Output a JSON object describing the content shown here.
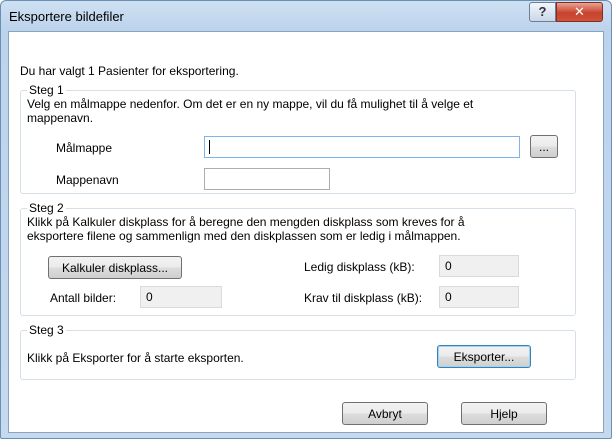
{
  "window": {
    "title": "Eksportere bildefiler",
    "help_glyph": "?",
    "close_glyph": "✕"
  },
  "intro_text": "Du har valgt 1 Pasienter for eksportering.",
  "step1": {
    "legend": "Steg 1",
    "description_line1": "Velg en målmappe nedenfor. Om det er en ny mappe, vil du få mulighet til å velge et",
    "description_line2": "mappenavn.",
    "target_folder_label": "Målmappe",
    "target_folder_value": "",
    "browse_label": "...",
    "folder_name_label": "Mappenavn",
    "folder_name_value": ""
  },
  "step2": {
    "legend": "Steg 2",
    "description_line1": "Klikk på Kalkuler diskplass for å beregne den mengden diskplass som kreves for å",
    "description_line2": "eksportere filene og sammenlign med den diskplassen som er ledig i målmappen.",
    "calculate_label": "Kalkuler diskplass...",
    "image_count_label": "Antall bilder:",
    "image_count_value": "0",
    "free_space_label": "Ledig diskplass (kB):",
    "free_space_value": "0",
    "required_space_label": "Krav til diskplass (kB):",
    "required_space_value": "0"
  },
  "step3": {
    "legend": "Steg 3",
    "description": "Klikk på Eksporter for å starte eksporten.",
    "export_label": "Eksporter..."
  },
  "footer": {
    "cancel_label": "Avbryt",
    "help_label": "Hjelp"
  }
}
